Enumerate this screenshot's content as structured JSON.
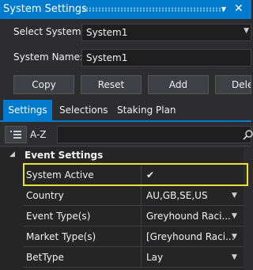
{
  "window": {
    "title": "System Settings"
  },
  "form": {
    "select_system_label": "Select System:",
    "select_system_value": "System1",
    "system_name_label": "System Name:",
    "system_name_value": "System1"
  },
  "buttons": {
    "copy": "Copy",
    "reset": "Reset",
    "add": "Add",
    "delete": "Dele"
  },
  "tabs": [
    {
      "label": "Settings",
      "active": true
    },
    {
      "label": "Selections",
      "active": false
    },
    {
      "label": "Staking Plan",
      "active": false
    }
  ],
  "toolbar": {
    "sort_alpha_label": "A-Z"
  },
  "property_grid": {
    "category": "Event Settings",
    "rows": [
      {
        "name": "System Active",
        "value": "✔",
        "dropdown": false,
        "highlighted": true
      },
      {
        "name": "Country",
        "value": "AU,GB,SE,US",
        "dropdown": true
      },
      {
        "name": "Event Type(s)",
        "value": "Greyhound Raci...",
        "dropdown": true
      },
      {
        "name": "Market Type(s)",
        "value": "[Greyhound Raci...",
        "dropdown": true
      },
      {
        "name": "BetType",
        "value": "Lay",
        "dropdown": true
      }
    ]
  },
  "colors": {
    "accent": "#007acc",
    "highlight": "#e8e33a",
    "background": "#2d2d30"
  }
}
